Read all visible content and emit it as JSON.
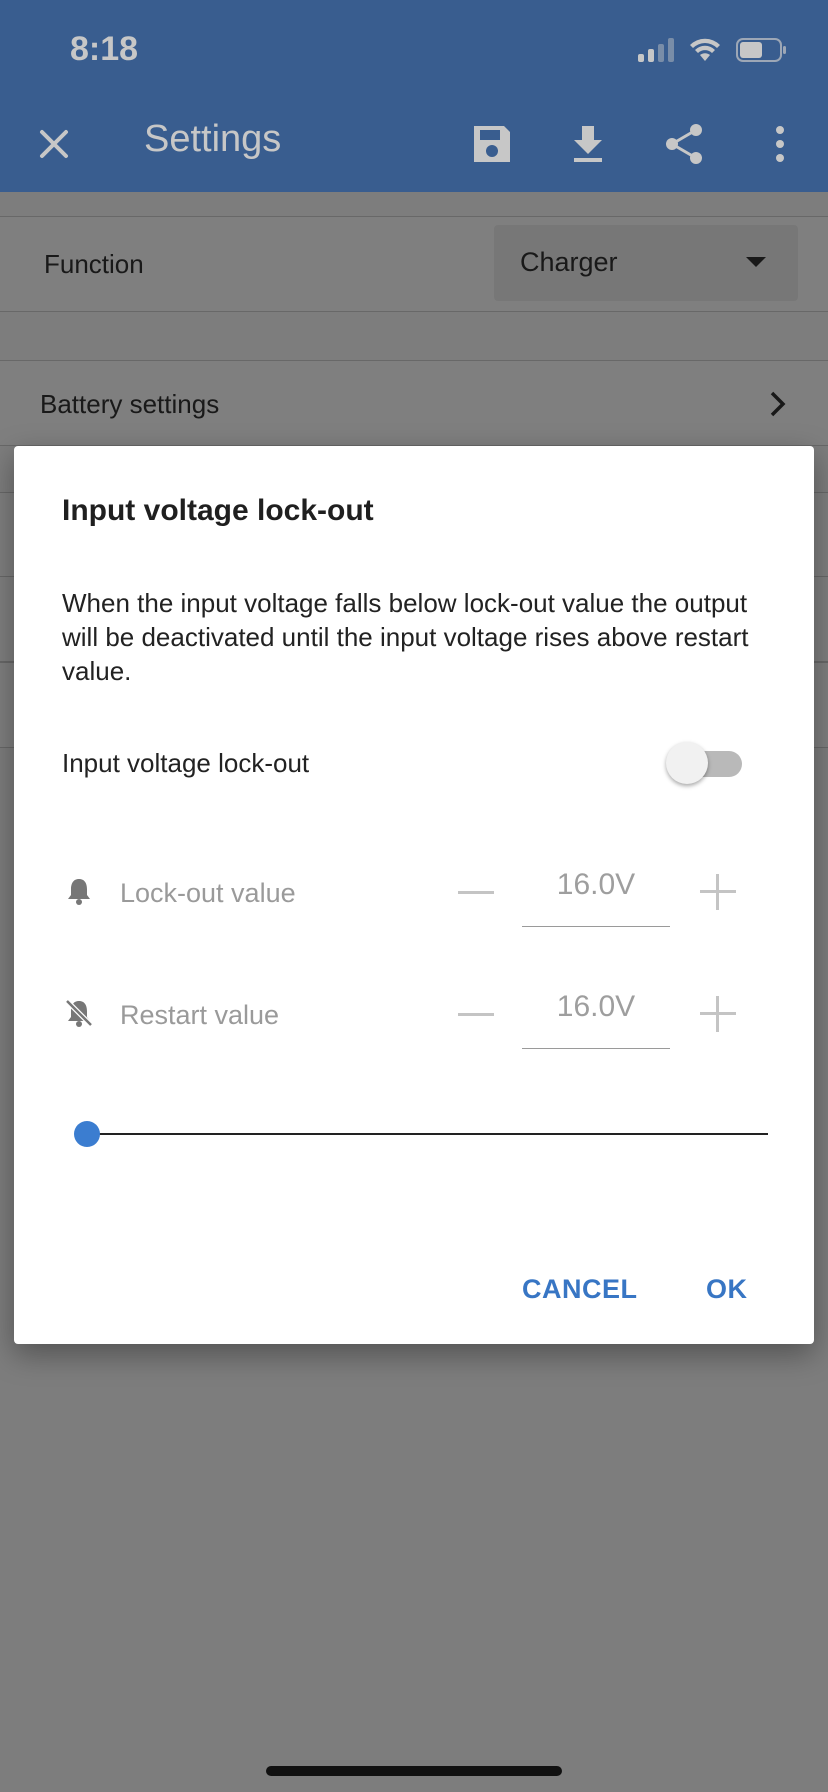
{
  "status_bar": {
    "time": "8:18"
  },
  "app_bar": {
    "title": "Settings"
  },
  "background": {
    "function_label": "Function",
    "function_value": "Charger",
    "battery_settings_label": "Battery settings"
  },
  "dialog": {
    "title": "Input voltage lock-out",
    "description": "When the input voltage falls below lock-out value the output will be deactivated until the input voltage rises above restart value.",
    "toggle_label": "Input voltage lock-out",
    "toggle_on": false,
    "lockout": {
      "label": "Lock-out value",
      "value": "16.0V"
    },
    "restart": {
      "label": "Restart value",
      "value": "16.0V"
    },
    "slider_value": 0,
    "cancel_label": "CANCEL",
    "ok_label": "OK"
  },
  "colors": {
    "primary": "#4a78b8",
    "accent": "#3876c4",
    "slider": "#3b7dd0"
  }
}
